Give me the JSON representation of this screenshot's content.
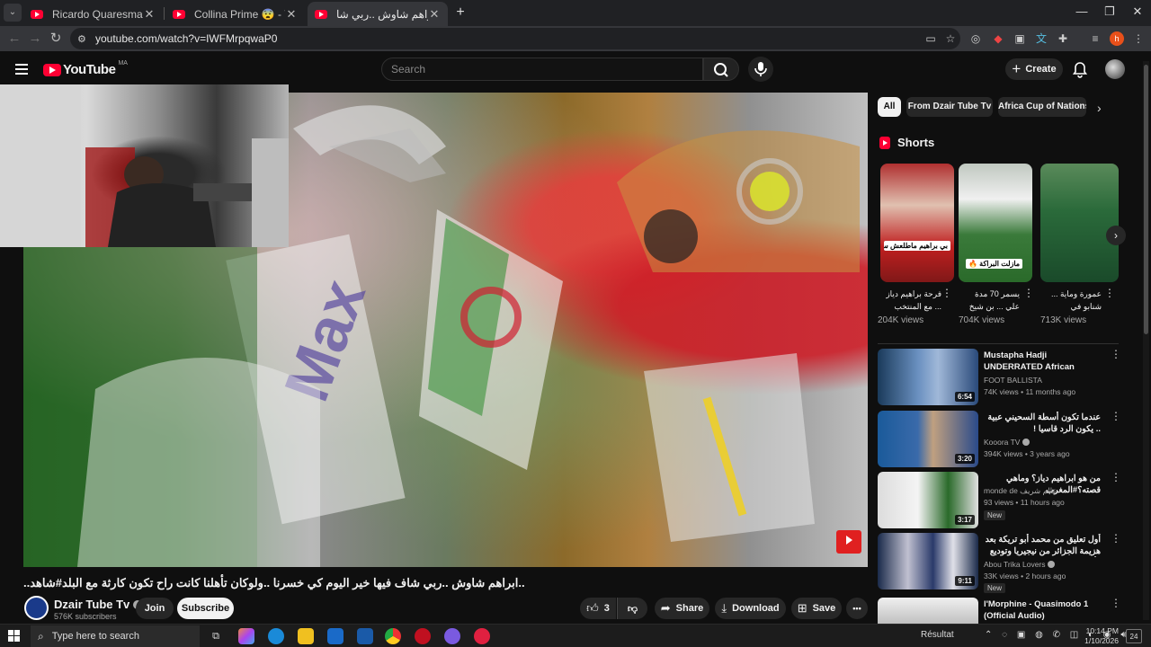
{
  "browser": {
    "tabs": [
      {
        "title": "Ricardo Quaresma - When Foot"
      },
      {
        "title": "Collina Prime 😨 - YouTube"
      },
      {
        "title": "شاهد..ابراهم شاوش ..ربي شا#"
      }
    ],
    "new_tab": "+",
    "url": "youtube.com/watch?v=IWFMrpqwaP0",
    "window_controls": {
      "minimize": "—",
      "restore": "❐",
      "close": "✕"
    }
  },
  "youtube": {
    "logo_text": "YouTube",
    "country_code": "MA",
    "search_placeholder": "Search",
    "create_label": "Create"
  },
  "video": {
    "title": "..ابراهم شاوش ..ربي شاف فيها خير اليوم كي خسرنا ..ولوكان تأهلنا كانت راح تكون كارثة مع البلد#شاهد..",
    "channel_name": "Dzair Tube Tv",
    "subscribers": "576K subscribers",
    "join_label": "Join",
    "subscribe_label": "Subscribe",
    "likes": "3",
    "share_label": "Share",
    "download_label": "Download",
    "save_label": "Save",
    "more_label": "•••"
  },
  "sidebar": {
    "chips": [
      {
        "label": "All",
        "selected": true
      },
      {
        "label": "From Dzair Tube Tv",
        "selected": false
      },
      {
        "label": "Africa Cup of Nations",
        "selected": false
      }
    ],
    "shorts_title": "Shorts",
    "shorts": [
      {
        "caption": "بي براهيم ماطلعش ساهل 😂😂😂",
        "title": "فرحة براهيم دياز ... مع المنتخب",
        "views": "204K views"
      },
      {
        "caption": "مازلت البراكة 🔥",
        "title": "يسمر 70 مدة علي ... بن شيخ يملك",
        "views": "704K views"
      },
      {
        "caption": "",
        "title": "عمورة وماية ... شنابو في",
        "views": "713K views"
      }
    ],
    "recommendations": [
      {
        "title": "Mustapha Hadji UNDERRATED African LEGEND",
        "channel": "FOOT BALLISTA",
        "meta": "74K views • 11 months ago",
        "duration": "6:54",
        "rtl": false,
        "is_new": false
      },
      {
        "title": "عندما تكون أسطة السحيني عبية .. يكون الرد قاسيا !",
        "channel": "Kooora TV",
        "meta": "394K views • 3 years ago",
        "duration": "3:20",
        "rtl": true,
        "is_new": false
      },
      {
        "title": "من هو ابراهيم دياز؟ وماهي قصته؟#المغرب",
        "channel": "monde de عالم شريف",
        "meta": "93 views • 11 hours ago",
        "duration": "3:17",
        "rtl": true,
        "is_new": true
      },
      {
        "title": "أول تعليق من محمد أبو تريكة بعد هزيمة الجزائر من نيجيريا وتوديع كأس امم افريقيا",
        "channel": "Abou Trika Lovers",
        "meta": "33K views • 2 hours ago",
        "duration": "9:11",
        "rtl": true,
        "is_new": true
      },
      {
        "title": "l'Morphine - Quasimodo 1 (Official Audio)",
        "channel": "",
        "meta": "",
        "duration": "",
        "rtl": false,
        "is_new": false
      }
    ],
    "new_badge": "New"
  },
  "taskbar": {
    "search_placeholder": "Type here to search",
    "weather": "Résultat",
    "time": "10:14 PM",
    "date": "1/10/2026",
    "notifications": "24"
  }
}
